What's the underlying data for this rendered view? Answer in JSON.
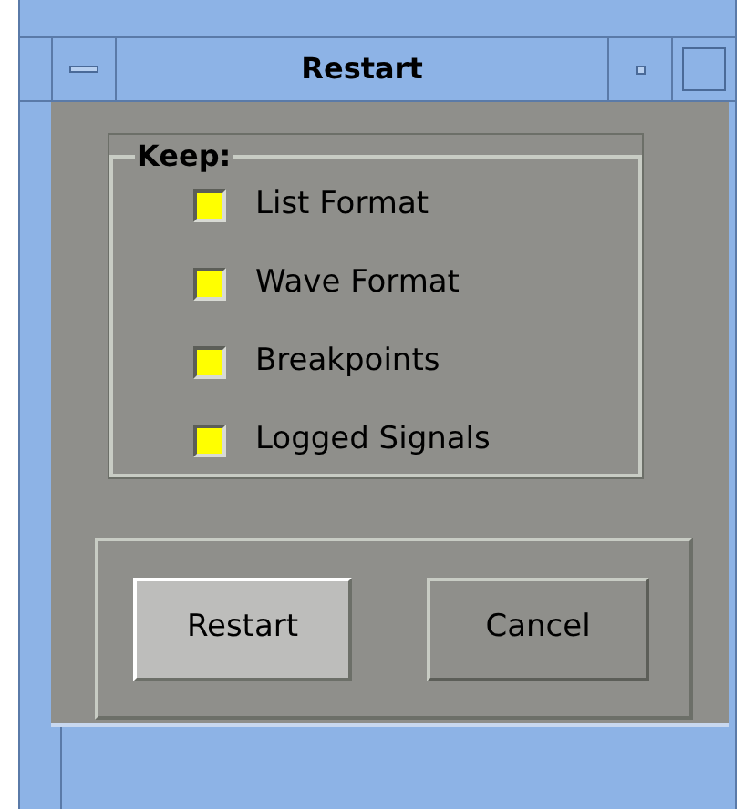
{
  "window": {
    "title": "Restart"
  },
  "keep_group": {
    "label": "Keep:",
    "options": [
      {
        "label": "List Format",
        "checked": true
      },
      {
        "label": "Wave Format",
        "checked": true
      },
      {
        "label": "Breakpoints",
        "checked": true
      },
      {
        "label": "Logged Signals",
        "checked": true
      }
    ]
  },
  "buttons": [
    {
      "label": "Restart",
      "default": true
    },
    {
      "label": "Cancel",
      "default": false
    }
  ]
}
